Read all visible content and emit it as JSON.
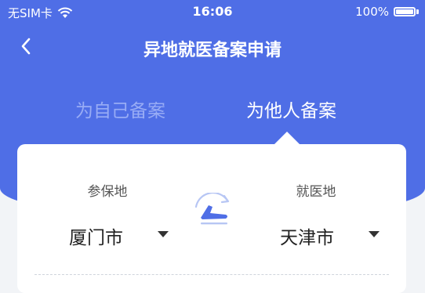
{
  "status_bar": {
    "carrier": "无SIM卡",
    "time": "16:06",
    "battery": "100%"
  },
  "nav": {
    "back_icon": "chevron-left-icon",
    "title": "异地就医备案申请"
  },
  "tabs": [
    {
      "label": "为自己备案",
      "active": false
    },
    {
      "label": "为他人备案",
      "active": true
    }
  ],
  "form": {
    "insured_place": {
      "label": "参保地",
      "value": "厦门市"
    },
    "treatment_place": {
      "label": "就医地",
      "value": "天津市"
    },
    "switch_icon": "flight-switch-icon"
  },
  "colors": {
    "primary": "#4f6ee6",
    "tab_inactive": "#98acf5",
    "card": "#ffffff",
    "page_bg": "#f2f4f7"
  }
}
